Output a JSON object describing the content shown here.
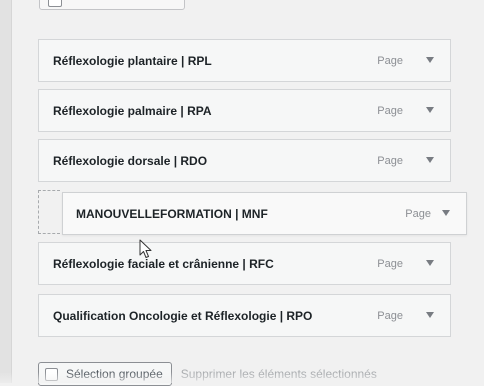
{
  "menu_items": [
    {
      "title": "Réflexologie plantaire | RPL",
      "type": "Page"
    },
    {
      "title": "Réflexologie palmaire | RPA",
      "type": "Page"
    },
    {
      "title": "Réflexologie dorsale | RDO",
      "type": "Page"
    },
    {
      "title": "MANOUVELLEFORMATION | MNF",
      "type": "Page"
    },
    {
      "title": "Réflexologie faciale et crânienne | RFC",
      "type": "Page"
    },
    {
      "title": "Qualification Oncologie et Réflexologie | RPO",
      "type": "Page"
    }
  ],
  "bulk": {
    "select_label": "Sélection groupée",
    "delete_label": "Supprimer les éléments sélectionnés"
  },
  "colors": {
    "item_background": "#f6f7f7",
    "item_border": "#d4d6d8",
    "title_text": "#1d2327",
    "muted_text": "#8c8f94"
  },
  "icons": {
    "expand": "triangle-down-icon",
    "cursor": "mouse-pointer-icon"
  }
}
